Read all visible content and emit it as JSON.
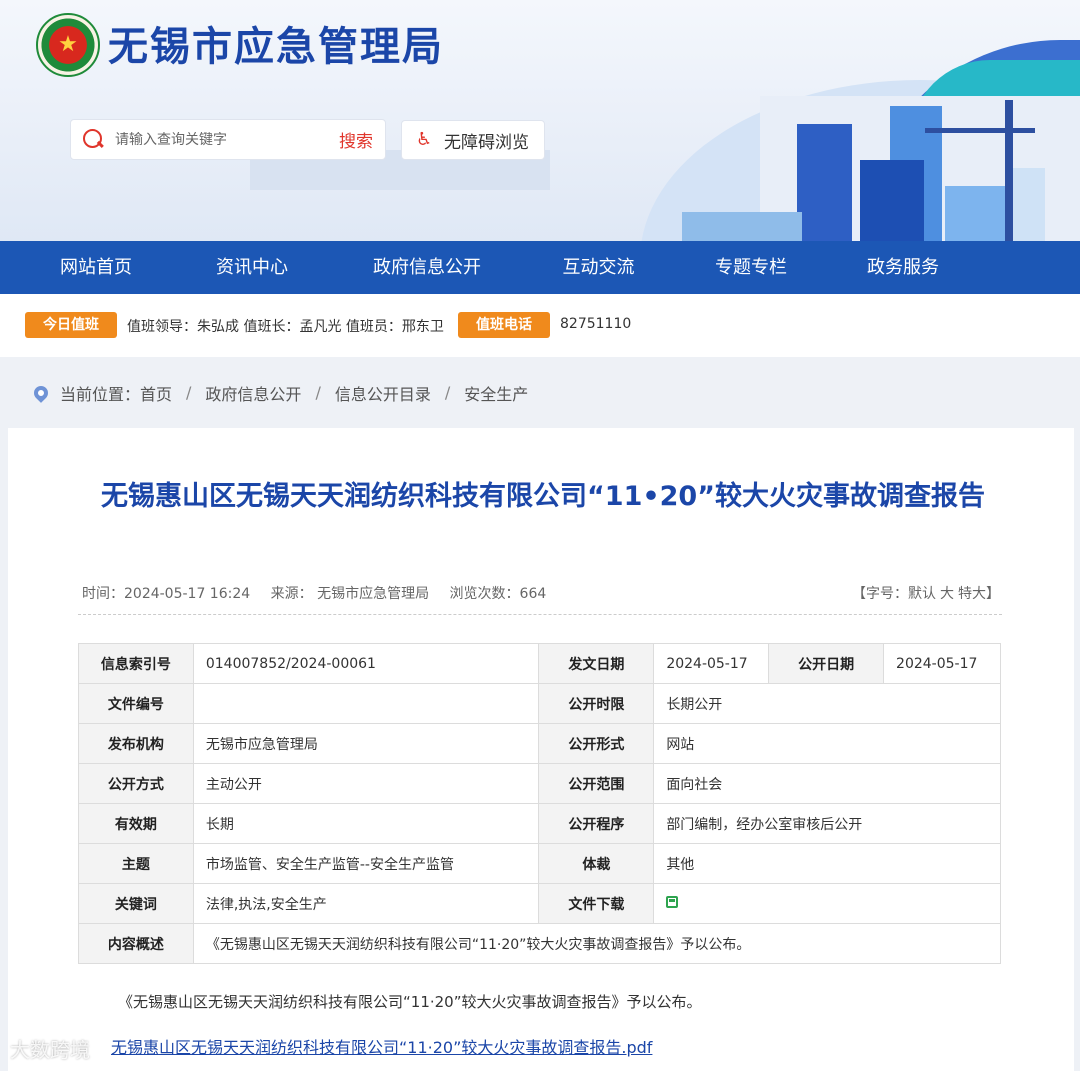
{
  "header": {
    "site_title": "无锡市应急管理局",
    "search": {
      "placeholder": "请输入查询关键字",
      "button_label": "搜索"
    },
    "accessibility_label": "无障碍浏览"
  },
  "nav": {
    "items": [
      "网站首页",
      "资讯中心",
      "政府信息公开",
      "互动交流",
      "专题专栏",
      "政务服务"
    ]
  },
  "duty": {
    "today_tag": "今日值班",
    "today_text": "值班领导：朱弘成 值班长：孟凡光 值班员：邢东卫",
    "phone_tag": "值班电话",
    "phone": "82751110"
  },
  "breadcrumb": {
    "prefix": "当前位置：",
    "items": [
      "首页",
      "政府信息公开",
      "信息公开目录",
      "安全生产"
    ]
  },
  "article": {
    "title": "无锡惠山区无锡天天润纺织科技有限公司“11•20”较大火灾事故调查报告",
    "time": "时间：2024-05-17 16:24",
    "source_label": "来源：",
    "source": "无锡市应急管理局",
    "views": "浏览次数：664",
    "fontsize": {
      "prefix": "【字号：",
      "default": "默认",
      "large": "大",
      "xlarge": "特大",
      "suffix": "】"
    },
    "info_table": {
      "index_no": {
        "label": "信息索引号",
        "value": "014007852/2024-00061"
      },
      "issue_date": {
        "label": "发文日期",
        "value": "2024-05-17"
      },
      "publish_date": {
        "label": "公开日期",
        "value": "2024-05-17"
      },
      "doc_no": {
        "label": "文件编号",
        "value": ""
      },
      "time_limit": {
        "label": "公开时限",
        "value": "长期公开"
      },
      "org": {
        "label": "发布机构",
        "value": "无锡市应急管理局"
      },
      "form": {
        "label": "公开形式",
        "value": "网站"
      },
      "method": {
        "label": "公开方式",
        "value": "主动公开"
      },
      "scope": {
        "label": "公开范围",
        "value": "面向社会"
      },
      "validity": {
        "label": "有效期",
        "value": "长期"
      },
      "procedure": {
        "label": "公开程序",
        "value": "部门编制，经办公室审核后公开"
      },
      "topic": {
        "label": "主题",
        "value": "市场监管、安全生产监管--安全生产监管"
      },
      "genre": {
        "label": "体裁",
        "value": "其他"
      },
      "keywords": {
        "label": "关键词",
        "value": "法律,执法,安全生产"
      },
      "download": {
        "label": "文件下载"
      },
      "summary": {
        "label": "内容概述",
        "value": "《无锡惠山区无锡天天润纺织科技有限公司“11·20”较大火灾事故调查报告》予以公布。"
      }
    },
    "body_text": "《无锡惠山区无锡天天润纺织科技有限公司“11·20”较大火灾事故调查报告》予以公布。",
    "attachment": "无锡惠山区无锡天天润纺织科技有限公司“11·20”较大火灾事故调查报告.pdf"
  },
  "watermark": "大数跨境",
  "colors": {
    "brand_blue": "#1c57b5",
    "title_blue": "#1b46a8",
    "accent_red": "#e0352b",
    "tag_orange": "#f08a1c"
  }
}
